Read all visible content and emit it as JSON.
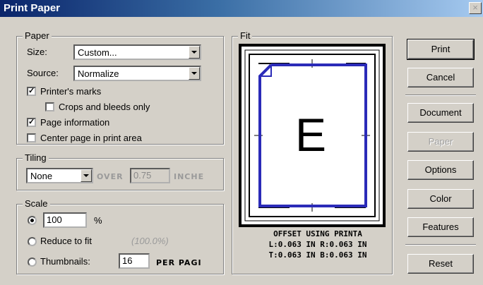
{
  "window": {
    "title": "Print Paper",
    "close_glyph": "×"
  },
  "paper": {
    "legend": "Paper",
    "size_label": "Size:",
    "size_value": "Custom...",
    "source_label": "Source:",
    "source_value": "Normalize",
    "printers_marks": "Printer's marks",
    "crops_bleeds": "Crops and bleeds only",
    "page_information": "Page information",
    "center_page": "Center page in print area",
    "printers_marks_checked": true,
    "crops_bleeds_checked": false,
    "page_information_checked": true,
    "center_page_checked": false
  },
  "tiling": {
    "legend": "Tiling",
    "mode_value": "None",
    "over_label": "OVER",
    "over_value": "0.75",
    "unit_label": "INCHE"
  },
  "scale": {
    "legend": "Scale",
    "percent_value": "100",
    "percent_sign": "%",
    "reduce_label": "Reduce to fit",
    "reduce_hint": "(100.0%)",
    "thumbnails_label": "Thumbnails:",
    "thumbnails_value": "16",
    "per_page_label": "PER PAGI",
    "selected": "percent"
  },
  "fit": {
    "legend": "Fit",
    "page_letter": "E",
    "line1": "OFFSET USING PRINTA",
    "line2": "L:0.063 IN R:0.063 IN",
    "line3": "T:0.063 IN B:0.063 IN"
  },
  "buttons": {
    "print": "Print",
    "cancel": "Cancel",
    "document": "Document",
    "paper": "Paper",
    "options": "Options",
    "color": "Color",
    "features": "Features",
    "reset": "Reset"
  },
  "check_glyph": "✓"
}
